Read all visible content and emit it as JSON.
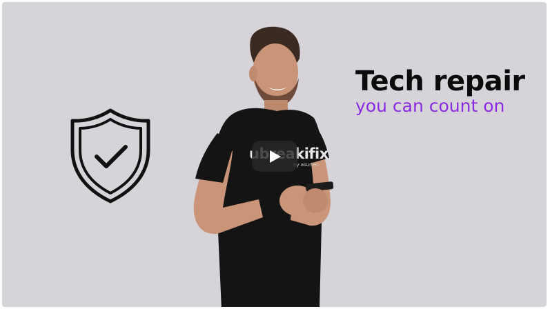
{
  "video": {
    "headline": "Tech repair",
    "tagline": "you can count on",
    "shirt_brand": "ubreakifix",
    "shirt_sub": "by asurion",
    "play_icon": "play-icon",
    "shield_icon": "shield-check-icon"
  },
  "colors": {
    "background": "#d6d3d9",
    "headline": "#0b0b0b",
    "tagline": "#8a2be2",
    "play_button": "#282828"
  }
}
